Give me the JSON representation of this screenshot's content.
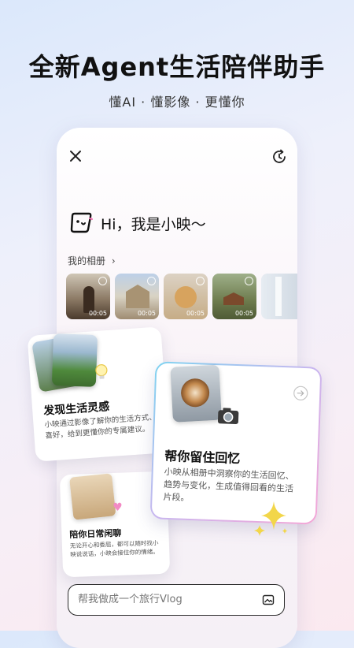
{
  "headline": "全新Agent生活陪伴助手",
  "subline": "懂AI · 懂影像 · 更懂你",
  "chat": {
    "greeting": "Hi，我是小映～",
    "album_link": "我的相册",
    "thumbnails": [
      {
        "duration": "00:05",
        "icon": "person-photo"
      },
      {
        "duration": "00:05",
        "icon": "building-photo"
      },
      {
        "duration": "00:05",
        "icon": "dog-photo"
      },
      {
        "duration": "00:05",
        "icon": "cabin-photo"
      },
      {
        "duration": "",
        "icon": "partial-photo"
      }
    ],
    "input_placeholder": "帮我做成一个旅行Vlog"
  },
  "cards": {
    "inspiration": {
      "title": "发现生活灵感",
      "desc_line1": "小映通过影像了解你的生活方式、",
      "desc_line2": "喜好，给到更懂你的专属建议。"
    },
    "memory": {
      "title": "帮你留住回忆",
      "desc_line1": "小映从相册中洞察你的生活回忆、",
      "desc_line2": "趋势与变化，生成值得回看的生活",
      "desc_line3": "片段。"
    },
    "chat": {
      "title": "陪你日常闲聊",
      "desc_line1": "无论开心和委屈，都可以随时找小",
      "desc_line2": "映说说话，小映会接住你的情绪。"
    }
  },
  "colors": {
    "accent_gradient_start": "#7fd3f0",
    "accent_gradient_end": "#f5a6d6",
    "sparkle": "#f2d64a"
  }
}
